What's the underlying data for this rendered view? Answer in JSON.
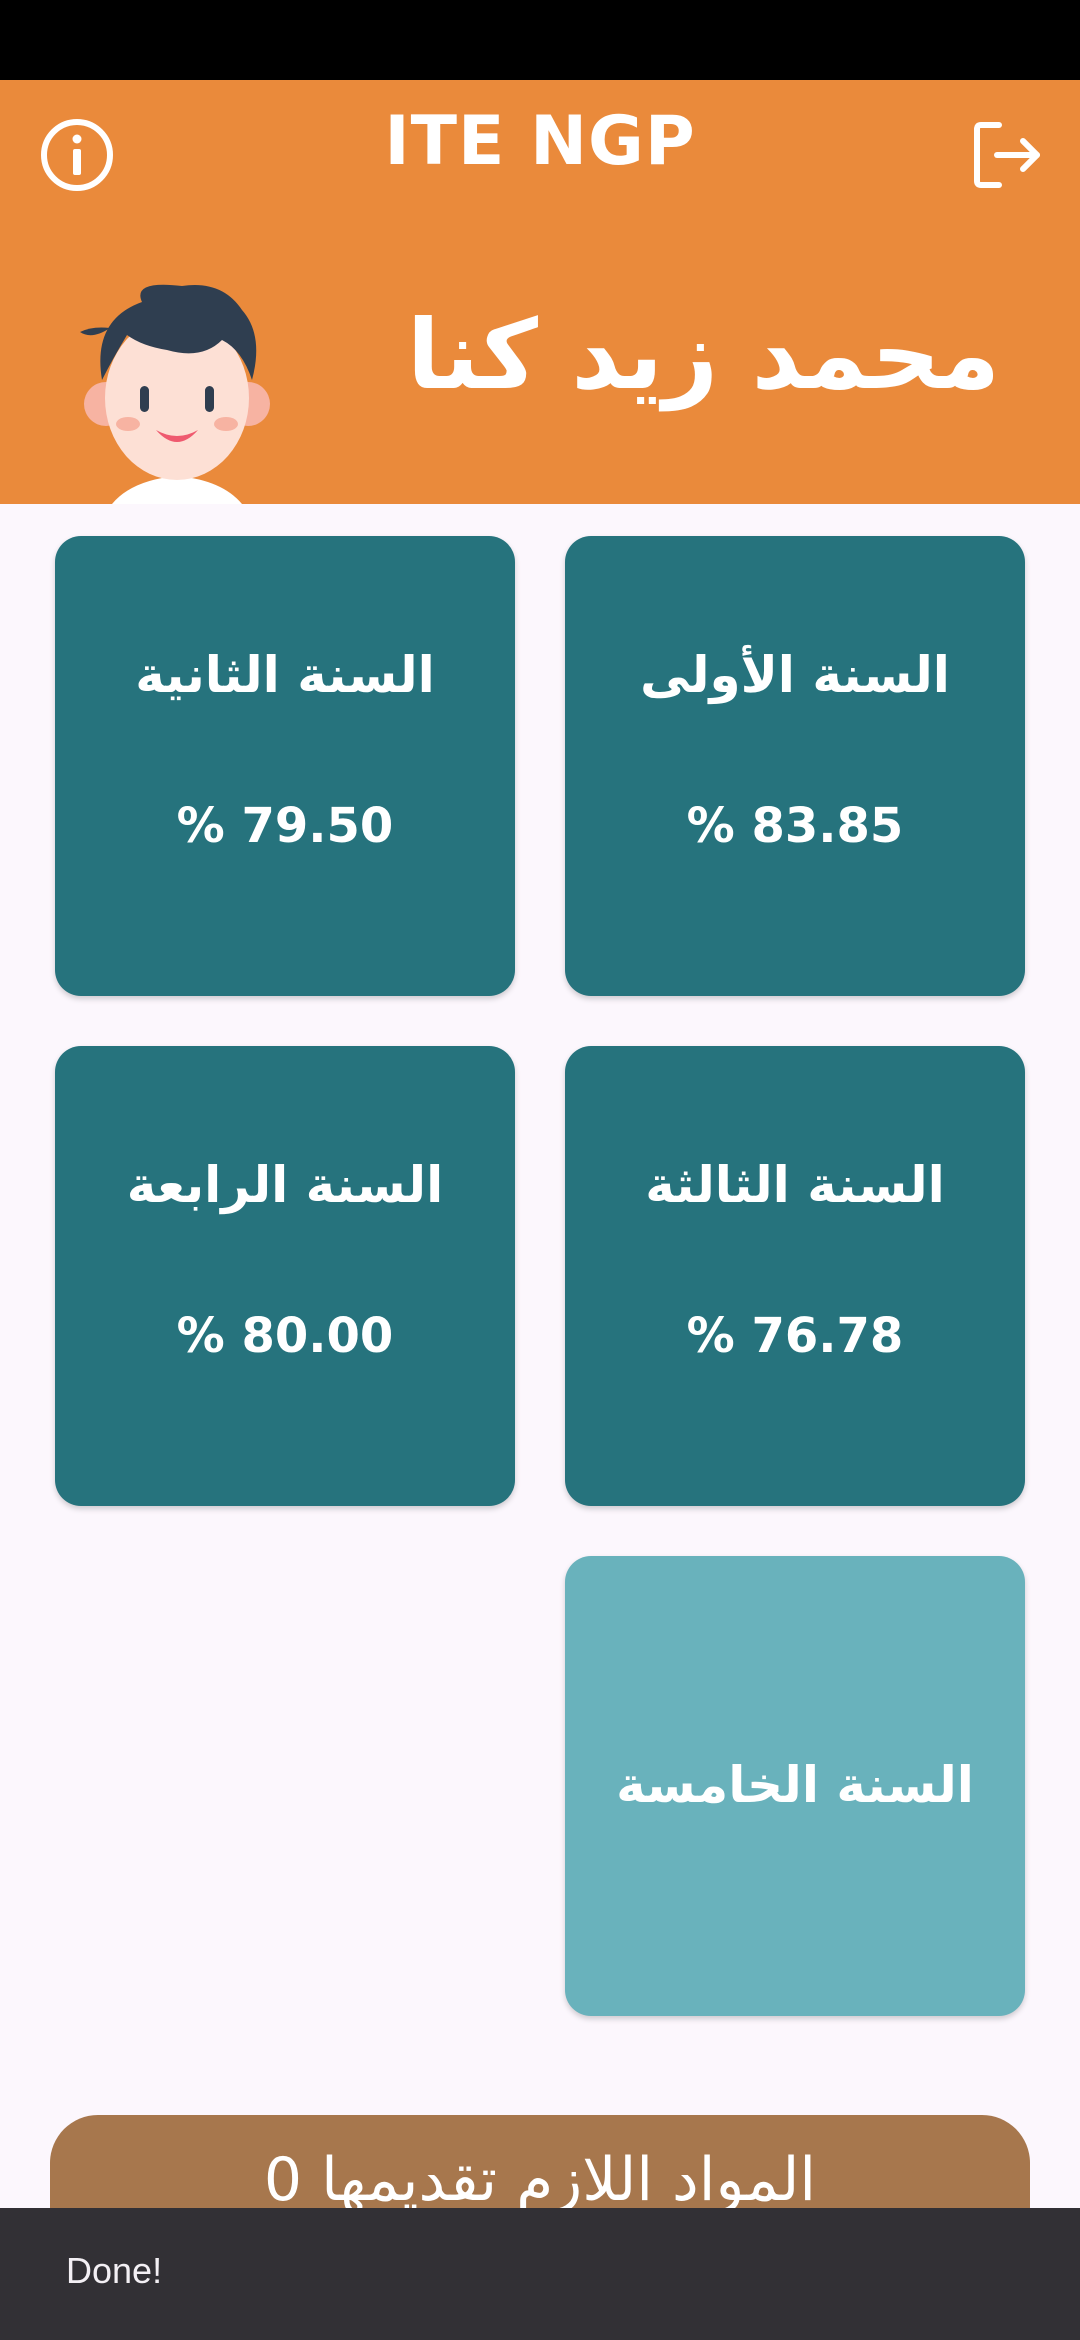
{
  "header": {
    "title": "ITE NGP",
    "student_name": "محمد زيد كنا",
    "info_icon": "info-icon",
    "logout_icon": "logout-icon",
    "avatar_icon": "student-avatar",
    "background_color": "#ea8a3b"
  },
  "years": [
    {
      "label": "السنة الأولى",
      "percent": "% 83.85"
    },
    {
      "label": "السنة الثانية",
      "percent": "% 79.50"
    },
    {
      "label": "السنة الثالثة",
      "percent": "% 76.78"
    },
    {
      "label": "السنة الرابعة",
      "percent": "% 80.00"
    },
    {
      "label": "السنة الخامسة",
      "percent": ""
    }
  ],
  "card_colors": {
    "completed": "#26737d",
    "pending": "#69b2bc"
  },
  "required_subjects": {
    "label": "المواد اللازم تقديمها 0",
    "color": "#a7774d"
  },
  "snackbar": {
    "message": "Done!"
  }
}
